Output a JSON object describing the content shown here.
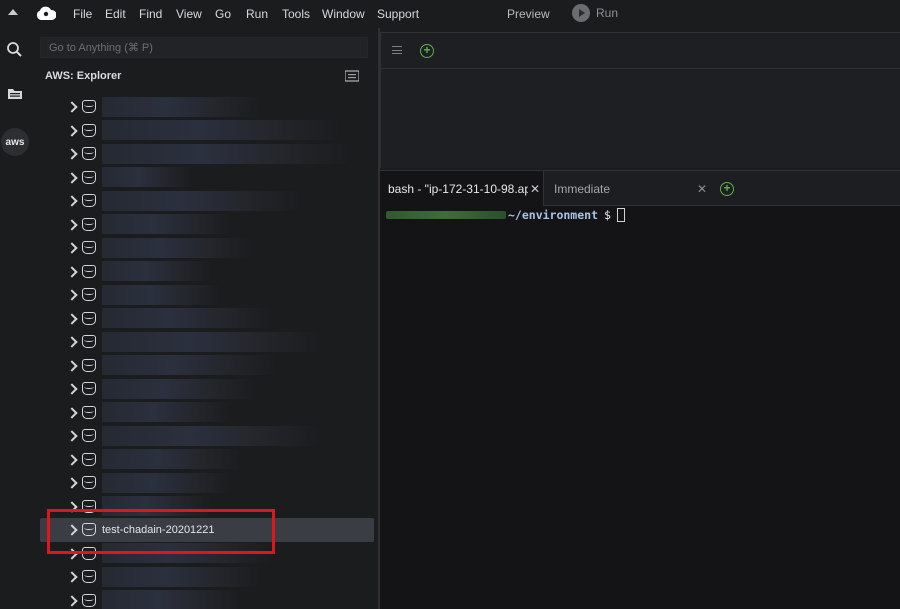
{
  "menubar": {
    "items": [
      "File",
      "Edit",
      "Find",
      "View",
      "Go",
      "Run",
      "Tools",
      "Window",
      "Support"
    ],
    "preview": "Preview",
    "run": "Run"
  },
  "explorer": {
    "search_placeholder": "Go to Anything (⌘ P)",
    "title": "AWS: Explorer",
    "nodes": [
      {
        "label": ""
      },
      {
        "label": ""
      },
      {
        "label": ""
      },
      {
        "label": ""
      },
      {
        "label": ""
      },
      {
        "label": ""
      },
      {
        "label": ""
      },
      {
        "label": ""
      },
      {
        "label": ""
      },
      {
        "label": ""
      },
      {
        "label": ""
      },
      {
        "label": ""
      },
      {
        "label": ""
      },
      {
        "label": ""
      },
      {
        "label": ""
      },
      {
        "label": ""
      },
      {
        "label": ""
      },
      {
        "label": ""
      },
      {
        "label": "test-chadain-20201221",
        "selected": true
      },
      {
        "label": ""
      },
      {
        "label": ""
      },
      {
        "label": ""
      }
    ]
  },
  "terminal": {
    "tabs": [
      {
        "label": "bash - \"ip-172-31-10-98.ap",
        "active": true
      },
      {
        "label": "Immediate",
        "active": false
      }
    ],
    "prompt_path": "~/environment",
    "prompt_symbol": "$"
  },
  "rail": {
    "aws_label": "aws"
  },
  "colors": {
    "accent_green": "#5fb04a",
    "highlight_red": "#e0161b",
    "selected_row": "#3b3d44"
  }
}
